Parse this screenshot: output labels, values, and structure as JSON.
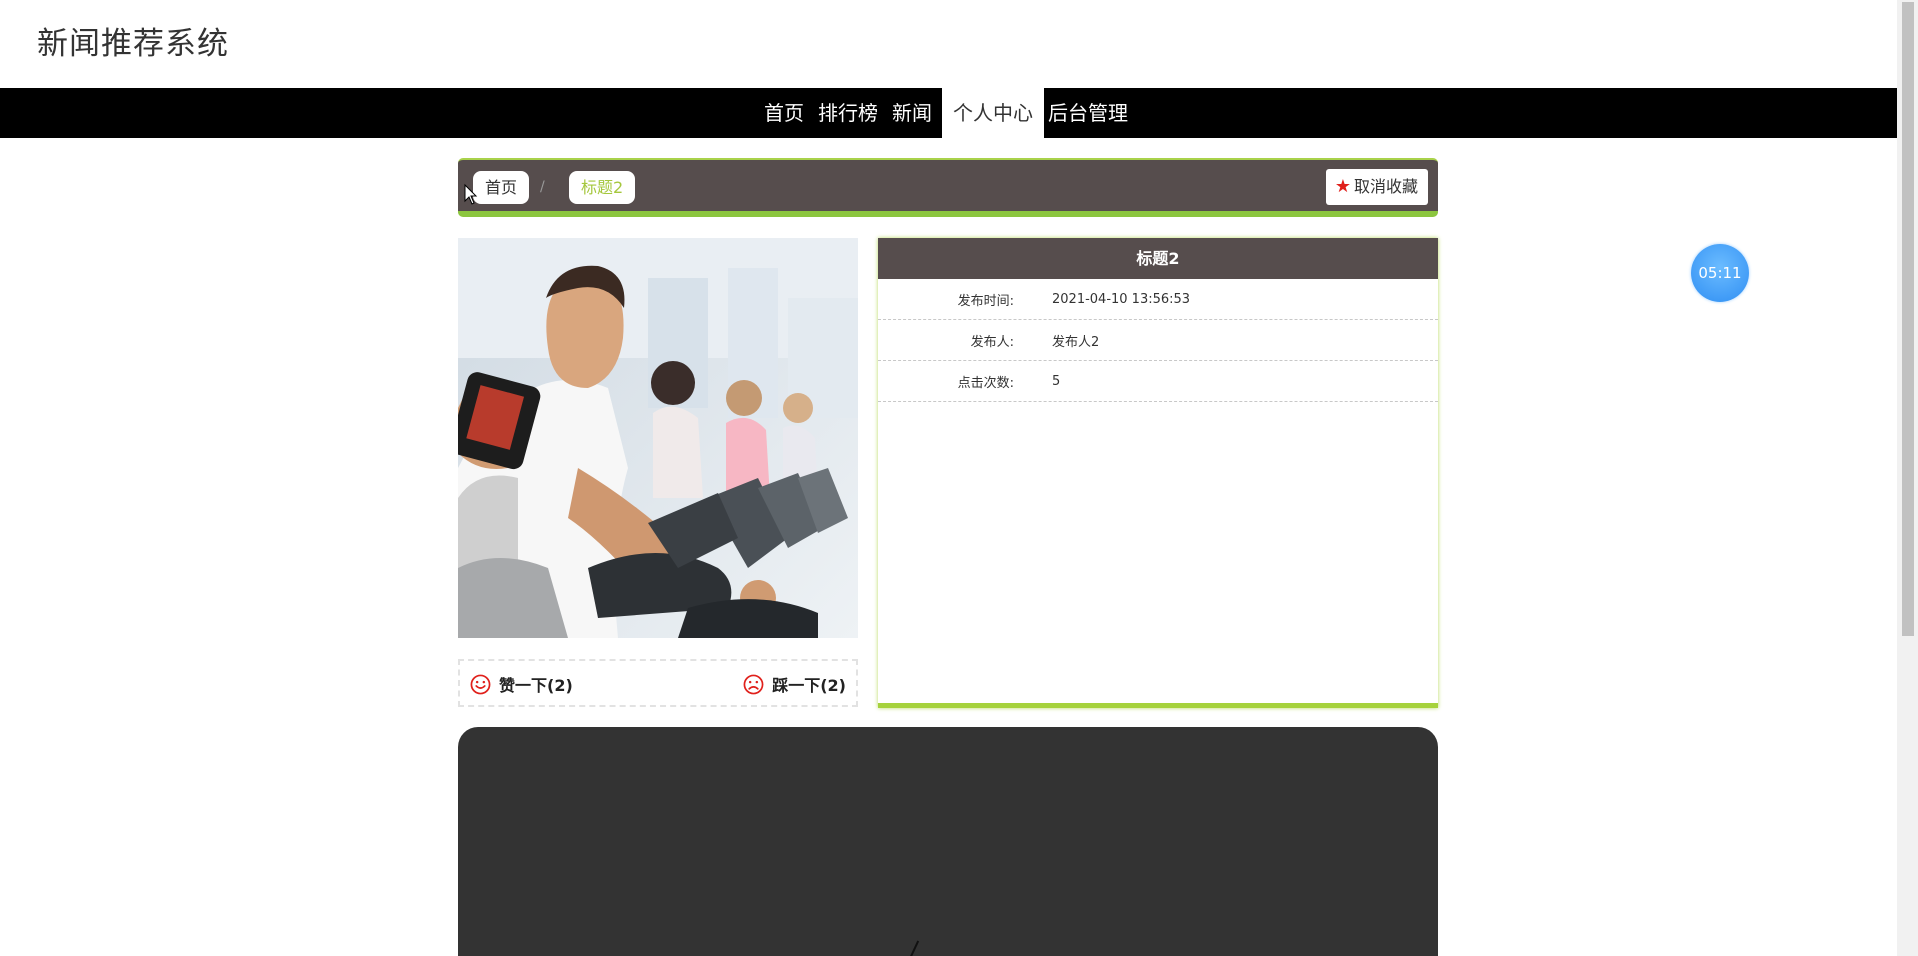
{
  "site": {
    "title": "新闻推荐系统"
  },
  "nav": {
    "items": [
      {
        "label": "首页",
        "active": false
      },
      {
        "label": "排行榜",
        "active": false
      },
      {
        "label": "新闻",
        "active": false
      },
      {
        "label": "个人中心",
        "active": true
      },
      {
        "label": "后台管理",
        "active": false
      }
    ]
  },
  "breadcrumb": {
    "home": "首页",
    "separator": "/",
    "current": "标题2"
  },
  "favorite": {
    "icon": "star-icon",
    "label": "取消收藏"
  },
  "votes": {
    "up_label": "赞一下(2)",
    "down_label": "踩一下(2)",
    "up_icon": "smile-face-icon",
    "down_icon": "sad-face-icon"
  },
  "info": {
    "title": "标题2",
    "rows": [
      {
        "key": "发布时间:",
        "value": "2021-04-10 13:56:53"
      },
      {
        "key": "发布人:",
        "value": "发布人2"
      },
      {
        "key": "点击次数:",
        "value": "5"
      }
    ]
  },
  "timer": {
    "text": "05:11"
  },
  "colors": {
    "nav_bg": "#000000",
    "panel_header": "#564d4d",
    "accent_green": "#8cc63f",
    "crumb_current": "#a5c73d",
    "star_red": "#e0201b",
    "timer_blue": "#2f8ef3",
    "video_bg": "#333333"
  }
}
